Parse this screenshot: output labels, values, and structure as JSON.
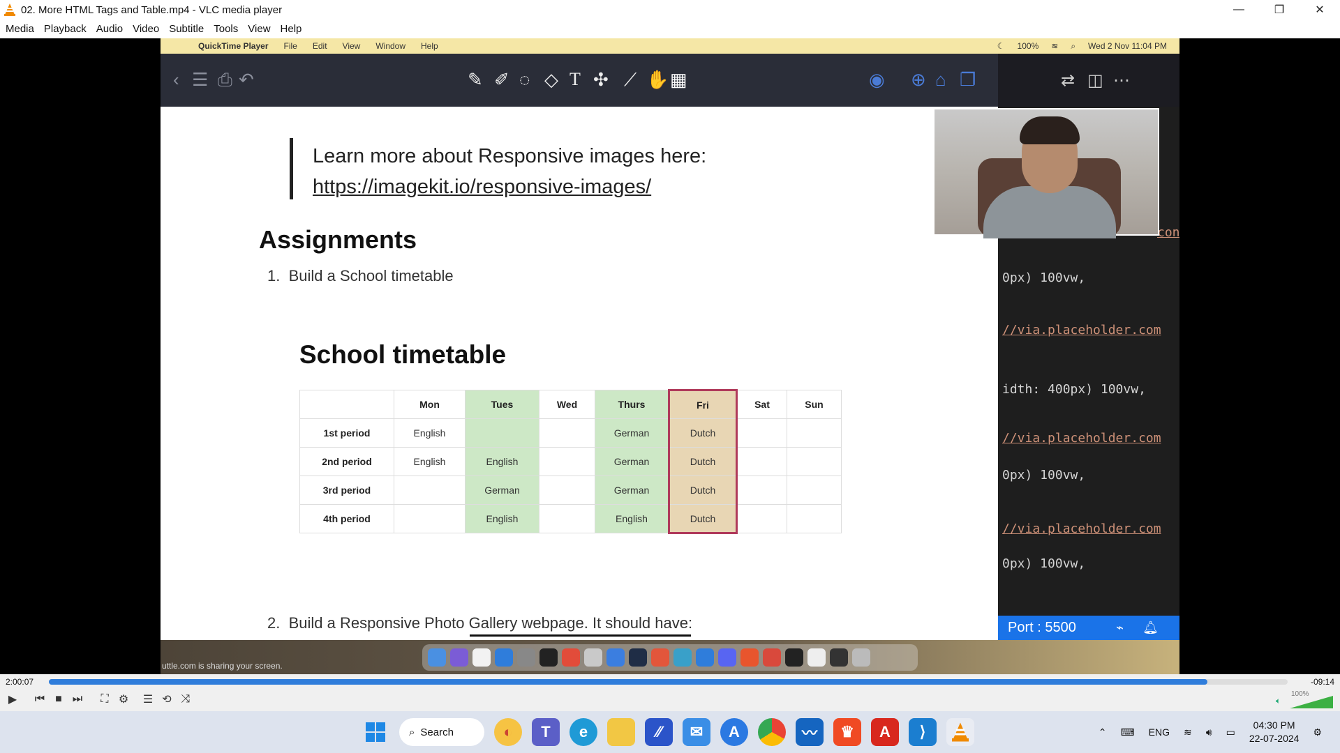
{
  "window": {
    "title": "02. More HTML Tags and Table.mp4 - VLC media player",
    "controls": [
      "—",
      "❐",
      "✕"
    ]
  },
  "menu": [
    "Media",
    "Playback",
    "Audio",
    "Video",
    "Subtitle",
    "Tools",
    "View",
    "Help"
  ],
  "mac": {
    "app_name": "QuickTime Player",
    "menu": [
      "File",
      "Edit",
      "View",
      "Window",
      "Help"
    ],
    "battery": "100%",
    "datetime": "Wed 2 Nov  11:04 PM"
  },
  "slide": {
    "quote_text": "Learn more about Responsive images here:",
    "quote_link": "https://imagekit.io/responsive-images/",
    "heading": "Assignments",
    "item1_num": "1.",
    "item1": "Build a School timetable",
    "table_title": "School timetable",
    "item2_num": "2.",
    "item2": "Build a Responsive Photo Gallery webpage. It should have:"
  },
  "timetable": {
    "headers": [
      "",
      "Mon",
      "Tues",
      "Wed",
      "Thurs",
      "Fri",
      "Sat",
      "Sun"
    ],
    "rows": [
      [
        "1st period",
        "English",
        "",
        "",
        "German",
        "Dutch",
        "",
        ""
      ],
      [
        "2nd period",
        "English",
        "English",
        "",
        "German",
        "Dutch",
        "",
        ""
      ],
      [
        "3rd period",
        "",
        "German",
        "",
        "German",
        "Dutch",
        "",
        ""
      ],
      [
        "4th period",
        "",
        "English",
        "",
        "English",
        "Dutch",
        "",
        ""
      ]
    ],
    "colors": {
      "tues": "#cde8c6",
      "thurs": "#cde8c6",
      "fri": "#e8d6b4",
      "fri_border": "#b03a5b"
    }
  },
  "code": {
    "lines": [
      "con",
      "0px) 100vw,",
      "//via.placeholder.com",
      "idth: 400px) 100vw,",
      "//via.placeholder.com",
      "0px) 100vw,",
      "//via.placeholder.com",
      "0px) 100vw,"
    ]
  },
  "status": {
    "port": "Port : 5500"
  },
  "share_text": "uttle.com is sharing your screen.",
  "player": {
    "elapsed": "2:00:07",
    "remaining": "-09:14",
    "progress": 0.935,
    "volume": "100%"
  },
  "taskbar": {
    "search": "Search",
    "lang": "ENG",
    "time": "04:30 PM",
    "date": "22-07-2024"
  }
}
